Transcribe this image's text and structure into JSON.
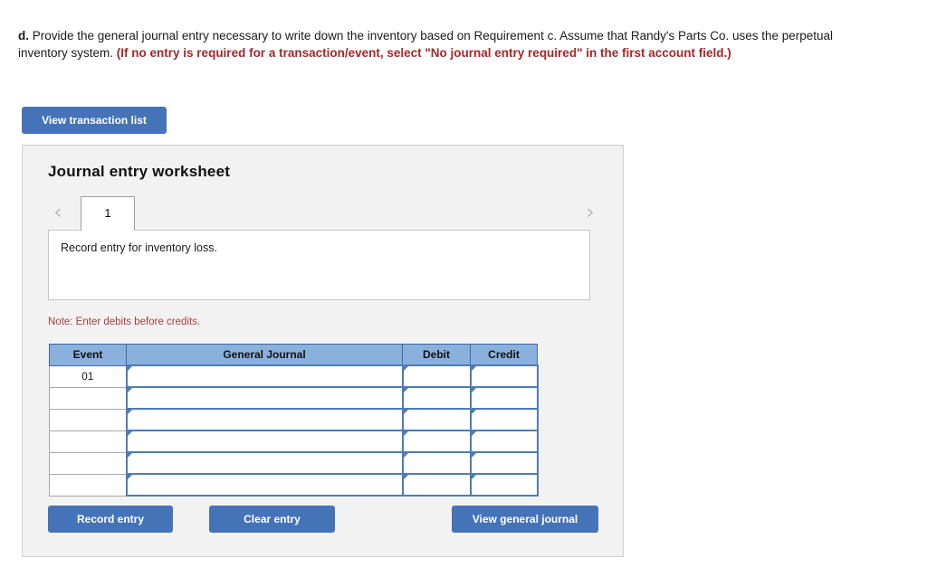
{
  "question": {
    "lead": "d.",
    "body": " Provide the general journal entry necessary to write down the inventory based on Requirement c. Assume that Randy's Parts Co. uses the perpetual inventory system. ",
    "instruction": "(If no entry is required for a transaction/event, select \"No journal entry required\" in the first account field.)"
  },
  "toolbar": {
    "view_transaction_list": "View transaction list"
  },
  "worksheet": {
    "title": "Journal entry worksheet",
    "prev_arrow": "‹",
    "next_arrow": "›",
    "tabs": [
      {
        "label": "1",
        "active": true
      }
    ],
    "scenario_text": "Record entry for inventory loss.",
    "note": "Note: Enter debits before credits.",
    "table": {
      "columns": [
        "Event",
        "General Journal",
        "Debit",
        "Credit"
      ],
      "rows": [
        {
          "event": "01",
          "general_journal": "",
          "debit": "",
          "credit": ""
        },
        {
          "event": "",
          "general_journal": "",
          "debit": "",
          "credit": ""
        },
        {
          "event": "",
          "general_journal": "",
          "debit": "",
          "credit": ""
        },
        {
          "event": "",
          "general_journal": "",
          "debit": "",
          "credit": ""
        },
        {
          "event": "",
          "general_journal": "",
          "debit": "",
          "credit": ""
        },
        {
          "event": "",
          "general_journal": "",
          "debit": "",
          "credit": ""
        }
      ]
    },
    "actions": {
      "record_entry": "Record entry",
      "clear_entry": "Clear entry",
      "view_general_journal": "View general journal"
    }
  },
  "colors": {
    "button_blue": "#4573b8",
    "header_blue": "#8ab0dc",
    "cell_border_blue": "#4e7cb6",
    "note_red": "#ad3c3c",
    "instruction_red": "#a3282a",
    "panel_gray": "#f2f2f2"
  }
}
